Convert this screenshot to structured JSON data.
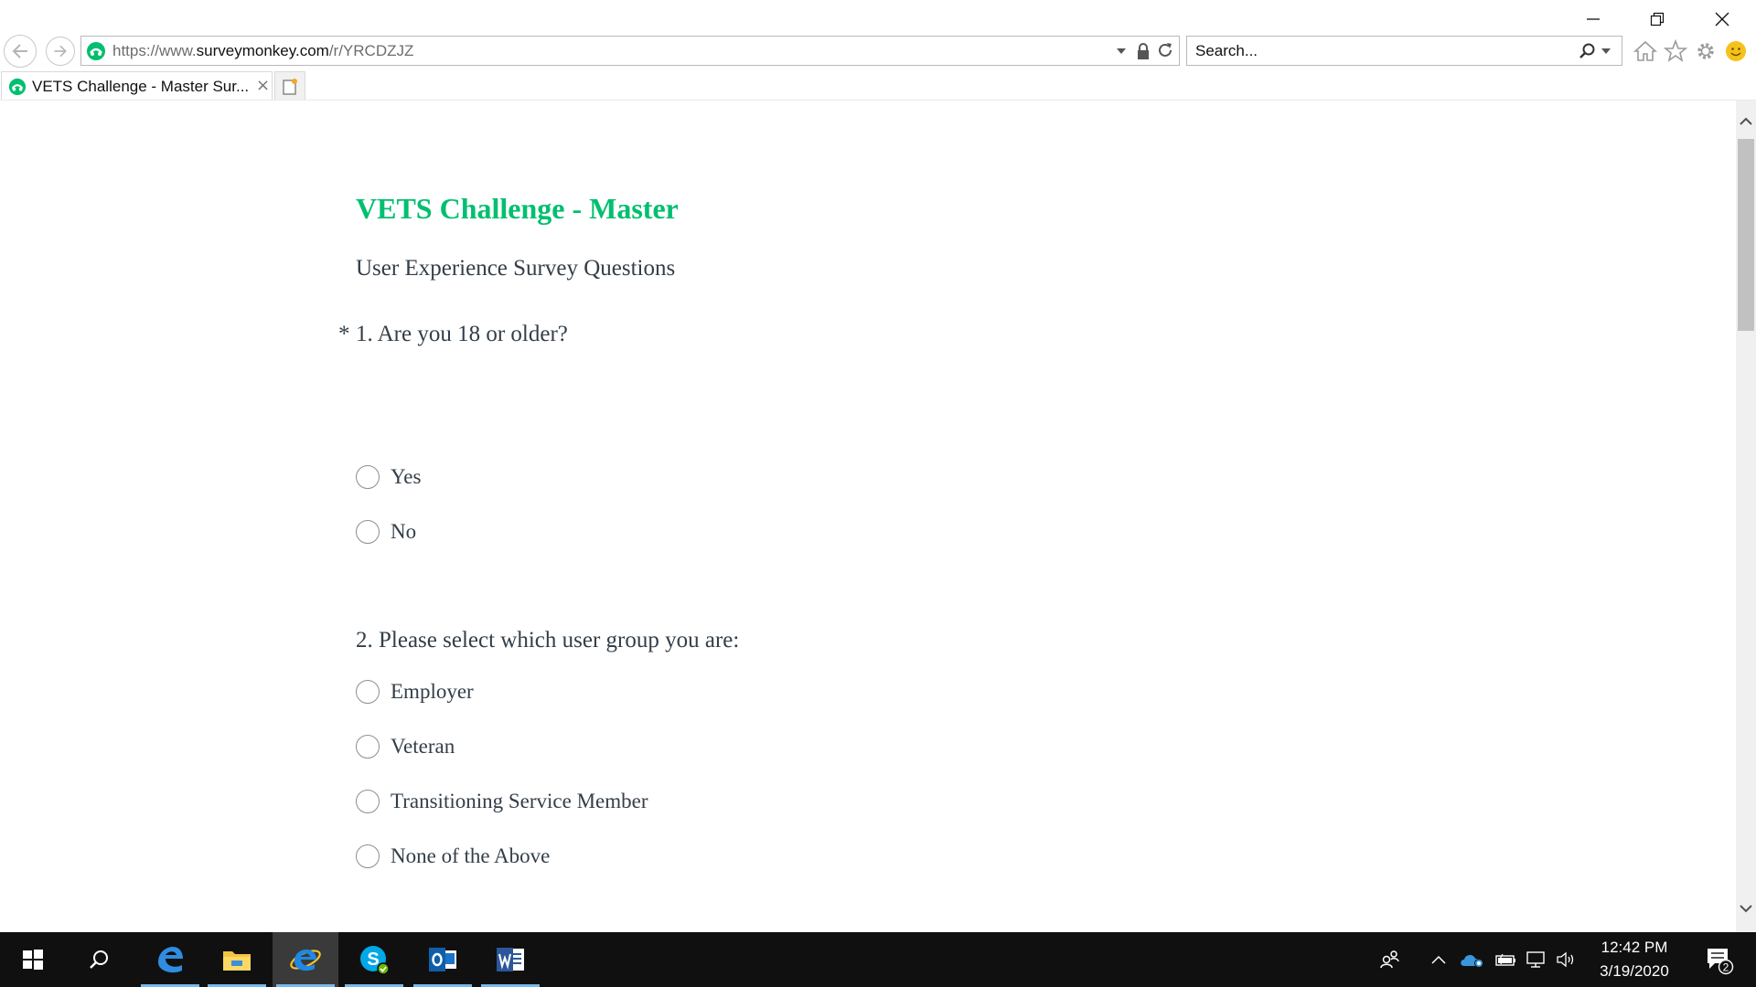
{
  "browser": {
    "url_prefix": "https://www.",
    "url_domain": "surveymonkey.com",
    "url_path": "/r/YRCDZJZ",
    "search_placeholder": "Search...",
    "tab_title": "VETS Challenge - Master Sur...",
    "tab_close": "×",
    "icons": [
      "back-icon",
      "forward-icon",
      "surveymonkey-icon",
      "dropdown-icon",
      "lock-icon",
      "refresh-icon",
      "search-icon",
      "home-icon",
      "favorites-star-icon",
      "settings-gear-icon",
      "smiley-feedback-icon",
      "new-tab-icon",
      "minimize-icon",
      "restore-icon",
      "close-icon"
    ]
  },
  "survey": {
    "title": "VETS Challenge - Master",
    "subtitle": "User Experience Survey Questions",
    "questions": [
      {
        "required_marker": "*",
        "title": "1. Are you 18 or older?",
        "options": [
          "Yes",
          "No"
        ]
      },
      {
        "required_marker": "",
        "title": "2. Please select which user group you are:",
        "options": [
          "Employer",
          "Veteran",
          "Transitioning Service Member",
          "None of the Above"
        ]
      }
    ]
  },
  "taskbar": {
    "time": "12:42 PM",
    "date": "3/19/2020",
    "notification_count": "2",
    "apps": [
      "start-icon",
      "search-icon",
      "edge-icon",
      "file-explorer-icon",
      "internet-explorer-icon",
      "skype-icon",
      "outlook-icon",
      "word-icon"
    ]
  },
  "colors": {
    "brand_green": "#00bf6f",
    "text": "#333e48",
    "taskbar_bg": "#101010",
    "taskbar_accent": "#76b9ed"
  }
}
